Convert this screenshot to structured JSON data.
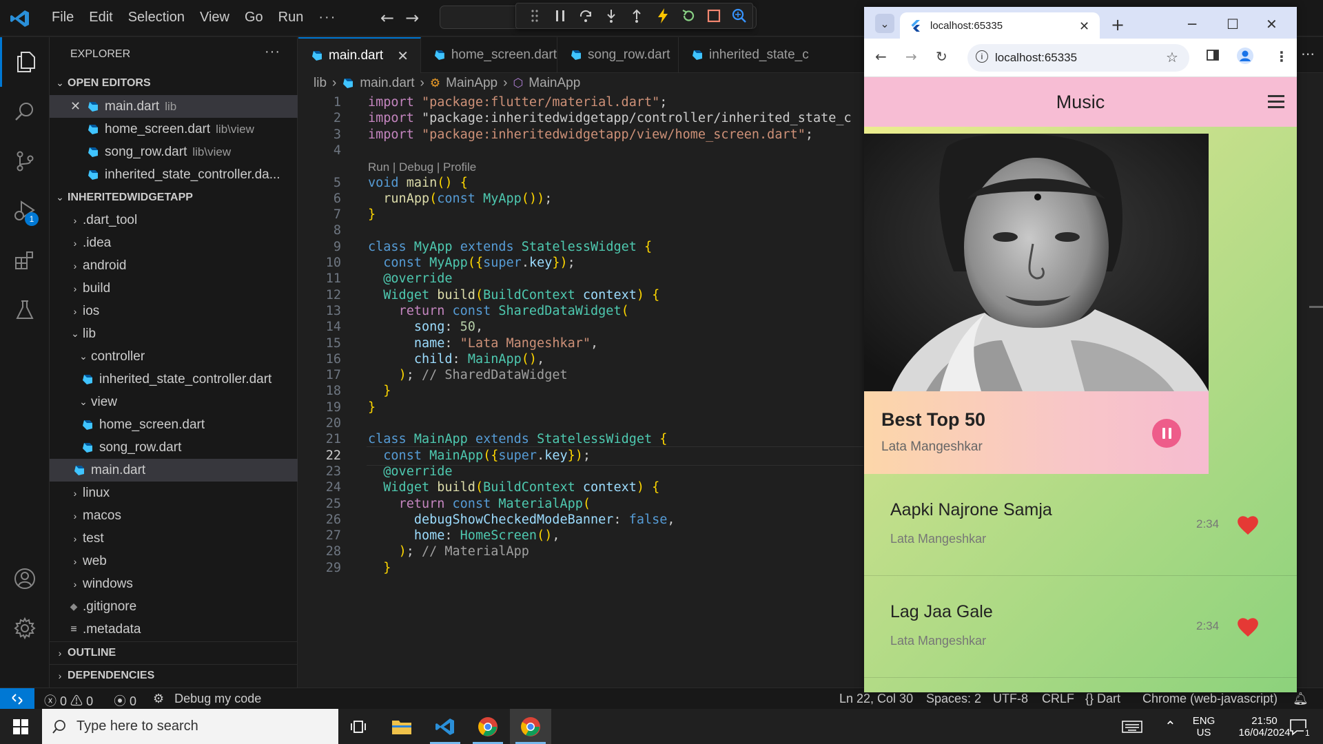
{
  "vscode": {
    "menu": [
      "File",
      "Edit",
      "Selection",
      "View",
      "Go",
      "Run",
      "···"
    ],
    "sidebar": {
      "title": "EXPLORER",
      "more": "···",
      "open_editors_label": "OPEN EDITORS",
      "open_editors": [
        {
          "name": "main.dart",
          "hint": "lib"
        },
        {
          "name": "home_screen.dart",
          "hint": "lib\\view"
        },
        {
          "name": "song_row.dart",
          "hint": "lib\\view"
        },
        {
          "name": "inherited_state_controller.da...",
          "hint": ""
        }
      ],
      "project_label": "INHERITEDWIDGETAPP",
      "tree": {
        "dart_tool": ".dart_tool",
        "idea": ".idea",
        "android": "android",
        "build": "build",
        "ios": "ios",
        "lib": "lib",
        "controller": "controller",
        "inherited_state_controller": "inherited_state_controller.dart",
        "view": "view",
        "home_screen": "home_screen.dart",
        "song_row": "song_row.dart",
        "main": "main.dart",
        "linux": "linux",
        "macos": "macos",
        "test": "test",
        "web": "web",
        "windows": "windows",
        "gitignore": ".gitignore",
        "metadata": ".metadata"
      },
      "outline_label": "OUTLINE",
      "dependencies_label": "DEPENDENCIES"
    },
    "tabs": [
      "main.dart",
      "home_screen.dart",
      "song_row.dart",
      "inherited_state_c"
    ],
    "breadcrumb": [
      "lib",
      "main.dart",
      "MainApp",
      "MainApp"
    ],
    "codelens": "Run | Debug | Profile",
    "code_lines": [
      "import \"package:flutter/material.dart\";",
      "import \"package:inheritedwidgetapp/controller/inherited_state_c",
      "import \"package:inheritedwidgetapp/view/home_screen.dart\";",
      "",
      "void main() {",
      "  runApp(const MyApp());",
      "}",
      "",
      "class MyApp extends StatelessWidget {",
      "  const MyApp({super.key});",
      "  @override",
      "  Widget build(BuildContext context) {",
      "    return const SharedDataWidget(",
      "      song: 50,",
      "      name: \"Lata Mangeshkar\",",
      "      child: MainApp(),",
      "    ); // SharedDataWidget",
      "  }",
      "}",
      "",
      "class MainApp extends StatelessWidget {",
      "  const MainApp({super.key});",
      "  @override",
      "  Widget build(BuildContext context) {",
      "    return const MaterialApp(",
      "      debugShowCheckedModeBanner: false,",
      "      home: HomeScreen(),",
      "    ); // MaterialApp",
      "  }"
    ],
    "line_numbers": [
      "1",
      "2",
      "3",
      "4",
      "5",
      "6",
      "7",
      "8",
      "9",
      "10",
      "11",
      "12",
      "13",
      "14",
      "15",
      "16",
      "17",
      "18",
      "19",
      "20",
      "21",
      "22",
      "23",
      "24",
      "25",
      "26",
      "27",
      "28",
      "29"
    ],
    "current_line": 22,
    "debug_badge": "1",
    "statusbar": {
      "errors": "0",
      "warnings": "0",
      "ports": "0",
      "debug": "Debug my code",
      "position": "Ln 22, Col 30",
      "spaces": "Spaces: 2",
      "encoding": "UTF-8",
      "eol": "CRLF",
      "language": "Dart",
      "target": "Chrome (web-javascript)"
    }
  },
  "chrome": {
    "tab_title": "localhost:65335",
    "url": "localhost:65335"
  },
  "app": {
    "title": "Music",
    "now_playing": {
      "title": "Best Top 50",
      "artist": "Lata Mangeshkar"
    },
    "songs": [
      {
        "title": "Aapki Najrone Samja",
        "artist": "Lata Mangeshkar",
        "duration": "2:34"
      },
      {
        "title": "Lag Jaa Gale",
        "artist": "Lata Mangeshkar",
        "duration": "2:34"
      }
    ]
  },
  "taskbar": {
    "search_placeholder": "Type here to search",
    "lang": "ENG",
    "region": "US",
    "time": "21:50",
    "date": "16/04/2024",
    "notification_count": "1"
  },
  "colors": {
    "vscode_accent": "#0078d4",
    "appbar": "#f7bdd4",
    "pause_button": "#ee5c8a",
    "heart": "#e53935"
  }
}
